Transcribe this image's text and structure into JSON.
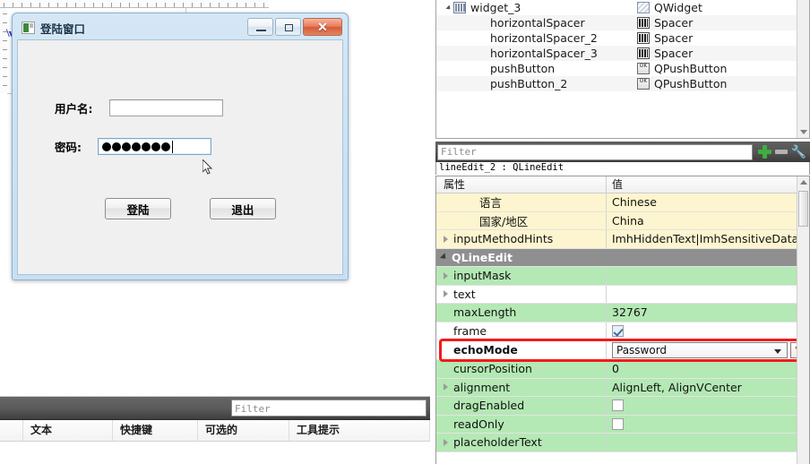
{
  "dialog": {
    "title": "登陆窗口",
    "icon": "app-icon",
    "window_buttons": [
      {
        "name": "minimize-button",
        "glyph": "minimize"
      },
      {
        "name": "maximize-button",
        "glyph": "maximize"
      },
      {
        "name": "close-button",
        "glyph": "✕"
      }
    ],
    "fields": [
      {
        "label": "用户名:",
        "value": "",
        "masked": false
      },
      {
        "label": "密码:",
        "value": "•••••••",
        "masked": true,
        "dot_count": 7
      }
    ],
    "buttons": [
      {
        "label": "登陆",
        "name": "login-button"
      },
      {
        "label": "退出",
        "name": "quit-button"
      }
    ]
  },
  "action_editor": {
    "filter_placeholder": "Filter",
    "columns": [
      "文本",
      "快捷键",
      "可选的",
      "工具提示"
    ]
  },
  "object_tree": {
    "rows": [
      {
        "name": "widget_3",
        "class": "QWidget",
        "icon": "container-icon",
        "indent": 26,
        "expandable": true
      },
      {
        "name": "horizontalSpacer",
        "class": "Spacer",
        "icon": "spacer-icon",
        "indent": 60,
        "expandable": false
      },
      {
        "name": "horizontalSpacer_2",
        "class": "Spacer",
        "icon": "spacer-icon",
        "indent": 60,
        "expandable": false
      },
      {
        "name": "horizontalSpacer_3",
        "class": "Spacer",
        "icon": "spacer-icon",
        "indent": 60,
        "expandable": false
      },
      {
        "name": "pushButton",
        "class": "QPushButton",
        "icon": "pushbutton-icon",
        "indent": 60,
        "expandable": false
      },
      {
        "name": "pushButton_2",
        "class": "QPushButton",
        "icon": "pushbutton-icon",
        "indent": 60,
        "expandable": false
      }
    ]
  },
  "tree_filter": {
    "placeholder": "Filter",
    "tools": [
      "plus-icon",
      "minus-icon",
      "wrench-icon"
    ]
  },
  "selected_object": "lineEdit_2 : QLineEdit",
  "property_editor": {
    "headers": {
      "key": "属性",
      "value": "值"
    },
    "rows": [
      {
        "key": "语言",
        "value": "Chinese",
        "style": "yellow",
        "indent": 2,
        "expandable": false
      },
      {
        "key": "国家/地区",
        "value": "China",
        "style": "yellow",
        "indent": 2,
        "expandable": false
      },
      {
        "key": "inputMethodHints",
        "value": "ImhHiddenText|ImhSensitiveData|I...",
        "style": "yellow",
        "indent": 1,
        "expandable": true
      },
      {
        "key": "QLineEdit",
        "value": "",
        "style": "group",
        "indent": 0,
        "expandable": true
      },
      {
        "key": "inputMask",
        "value": "",
        "style": "green",
        "indent": 1,
        "expandable": true
      },
      {
        "key": "text",
        "value": "",
        "style": "white",
        "indent": 1,
        "expandable": true
      },
      {
        "key": "maxLength",
        "value": "32767",
        "style": "green",
        "indent": 1,
        "expandable": false
      },
      {
        "key": "frame",
        "value": "checkbox-checked",
        "style": "white",
        "indent": 1,
        "expandable": false
      },
      {
        "key": "echoMode",
        "value": "Password",
        "style": "highlight",
        "indent": 1,
        "expandable": false,
        "editor": "combobox"
      },
      {
        "key": "cursorPosition",
        "value": "0",
        "style": "green",
        "indent": 1,
        "expandable": false
      },
      {
        "key": "alignment",
        "value": "AlignLeft, AlignVCenter",
        "style": "green",
        "indent": 1,
        "expandable": true
      },
      {
        "key": "dragEnabled",
        "value": "checkbox-unchecked",
        "style": "green",
        "indent": 1,
        "expandable": false
      },
      {
        "key": "readOnly",
        "value": "checkbox-unchecked",
        "style": "green",
        "indent": 1,
        "expandable": false
      },
      {
        "key": "placeholderText",
        "value": "",
        "style": "green",
        "indent": 1,
        "expandable": true
      }
    ],
    "highlight_color": "#f31a1a",
    "reset_button": "↰"
  }
}
